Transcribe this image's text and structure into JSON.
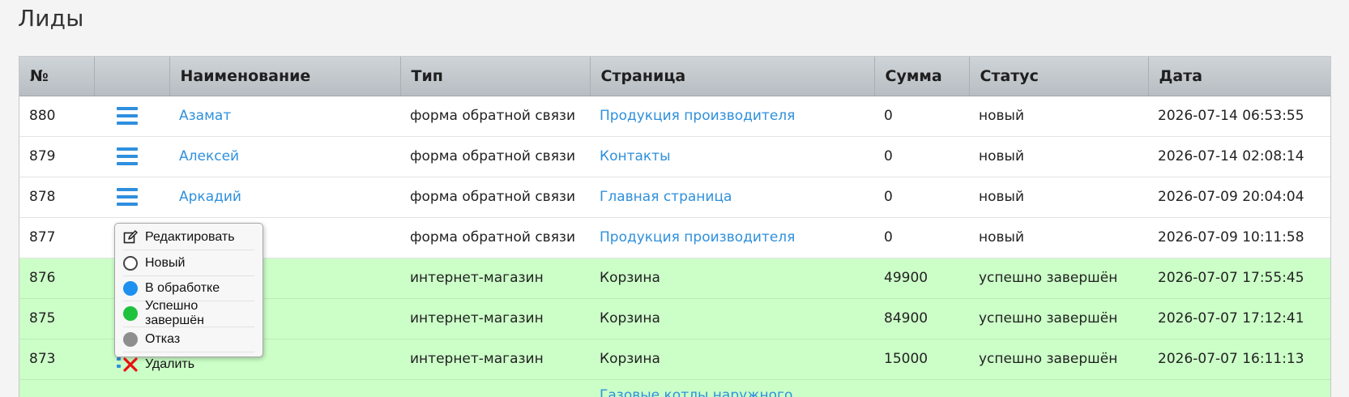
{
  "page": {
    "title": "Лиды"
  },
  "table": {
    "headers": [
      "№",
      "",
      "Наименование",
      "Тип",
      "Страница",
      "Сумма",
      "Статус",
      "Дата"
    ],
    "rows": [
      {
        "num": "880",
        "name": "Азамат",
        "type": "форма обратной связи",
        "page": "Продукция производителя",
        "page_link": true,
        "sum": "0",
        "status": "новый",
        "date": "2026-07-14 06:53:55",
        "done": false
      },
      {
        "num": "879",
        "name": "Алексей",
        "type": "форма обратной связи",
        "page": "Контакты",
        "page_link": true,
        "sum": "0",
        "status": "новый",
        "date": "2026-07-14 02:08:14",
        "done": false
      },
      {
        "num": "878",
        "name": "Аркадий",
        "type": "форма обратной связи",
        "page": "Главная страница",
        "page_link": true,
        "sum": "0",
        "status": "новый",
        "date": "2026-07-09 20:04:04",
        "done": false
      },
      {
        "num": "877",
        "name": "",
        "type": "форма обратной связи",
        "page": "Продукция производителя",
        "page_link": true,
        "sum": "0",
        "status": "новый",
        "date": "2026-07-09 10:11:58",
        "done": false
      },
      {
        "num": "876",
        "name": "",
        "type": "интернет-магазин",
        "page": "Корзина",
        "page_link": false,
        "sum": "49900",
        "status": "успешно завершён",
        "date": "2026-07-07 17:55:45",
        "done": true
      },
      {
        "num": "875",
        "name": "",
        "type": "интернет-магазин",
        "page": "Корзина",
        "page_link": false,
        "sum": "84900",
        "status": "успешно завершён",
        "date": "2026-07-07 17:12:41",
        "done": true
      },
      {
        "num": "873",
        "name": "",
        "type": "интернет-магазин",
        "page": "Корзина",
        "page_link": false,
        "sum": "15000",
        "status": "успешно завершён",
        "date": "2026-07-07 16:11:13",
        "done": true
      },
      {
        "num": "",
        "name": "",
        "type": "",
        "page": "Газовые котлы наружного",
        "page_link": true,
        "sum": "",
        "status": "",
        "date": "",
        "done": true
      }
    ]
  },
  "context_menu": {
    "items": [
      {
        "label": "Редактировать",
        "icon": "edit-icon"
      },
      {
        "label": "Новый",
        "icon": "status-new-icon",
        "color": "#ffffff"
      },
      {
        "label": "В обработке",
        "icon": "status-processing-icon",
        "color": "#1e90ef"
      },
      {
        "label": "Успешно завершён",
        "icon": "status-success-icon",
        "color": "#1ec23c"
      },
      {
        "label": "Отказ",
        "icon": "status-rejected-icon",
        "color": "#8e8e8e"
      },
      {
        "label": "Удалить",
        "icon": "delete-icon",
        "color": "#e81010"
      }
    ]
  },
  "colors": {
    "link": "#2f90dc",
    "done_row": "#ccffc8",
    "menu_icon": "#2f8fdf"
  }
}
